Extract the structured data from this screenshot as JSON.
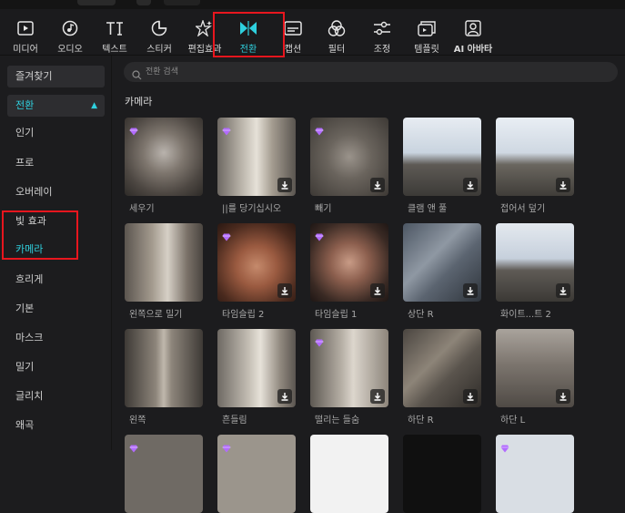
{
  "toolbar": {
    "items": [
      {
        "label": "미디어",
        "icon": "media-icon"
      },
      {
        "label": "오디오",
        "icon": "audio-icon"
      },
      {
        "label": "텍스트",
        "icon": "text-icon"
      },
      {
        "label": "스티커",
        "icon": "sticker-icon"
      },
      {
        "label": "편집효과",
        "icon": "effects-icon"
      },
      {
        "label": "전환",
        "icon": "transition-icon",
        "active": true
      },
      {
        "label": "캡션",
        "icon": "caption-icon"
      },
      {
        "label": "필터",
        "icon": "filter-icon"
      },
      {
        "label": "조정",
        "icon": "adjust-icon"
      },
      {
        "label": "템플릿",
        "icon": "template-icon"
      },
      {
        "label": "AI 아바타",
        "icon": "ai-avatar-icon"
      }
    ],
    "accent_color": "#2fd0de",
    "highlight_color": "#e8161e"
  },
  "sidebar": {
    "favorites": "즐겨찾기",
    "transitions": "전환",
    "items": [
      "인기",
      "프로",
      "오버레이",
      "빛 효과",
      "카메라",
      "흐리게",
      "기본",
      "마스크",
      "밀기",
      "글리치",
      "왜곡"
    ],
    "selected": "카메라"
  },
  "search": {
    "placeholder": "전환 검색"
  },
  "section_title": "카메라",
  "tiles": [
    {
      "caption": "세우기",
      "premium": true,
      "download": false
    },
    {
      "caption": "||를 당기십시오",
      "premium": true,
      "download": true
    },
    {
      "caption": "빼기",
      "premium": true,
      "download": true
    },
    {
      "caption": "클램 앤 풀",
      "premium": false,
      "download": true
    },
    {
      "caption": "접어서 덮기",
      "premium": false,
      "download": true
    },
    {
      "caption": "왼쪽으로 밀기",
      "premium": false,
      "download": false
    },
    {
      "caption": "타임슬립 2",
      "premium": true,
      "download": true
    },
    {
      "caption": "타임슬립 1",
      "premium": true,
      "download": true
    },
    {
      "caption": "상단 R",
      "premium": false,
      "download": true
    },
    {
      "caption": "화이트...트 2",
      "premium": false,
      "download": true
    },
    {
      "caption": "왼쪽",
      "premium": false,
      "download": false
    },
    {
      "caption": "흔들림",
      "premium": false,
      "download": true
    },
    {
      "caption": "떨리는 들숨",
      "premium": true,
      "download": true
    },
    {
      "caption": "하단 R",
      "premium": false,
      "download": true
    },
    {
      "caption": "하단 L",
      "premium": false,
      "download": true
    }
  ],
  "partial_row_premium": [
    true,
    true,
    false,
    false,
    true
  ]
}
